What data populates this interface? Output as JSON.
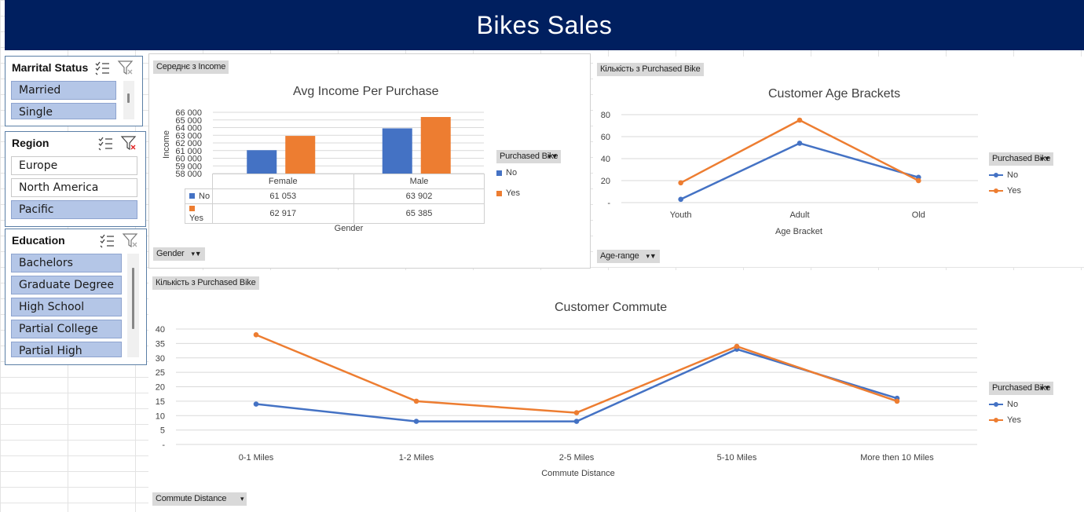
{
  "app": {
    "title": "Bikes Sales"
  },
  "colors": {
    "banner": "#001f5f",
    "no": "#4472c4",
    "yes": "#ed7d31",
    "selected": "#b4c6e7"
  },
  "slicers": {
    "marital": {
      "title": "Marrital Status",
      "items": [
        {
          "label": "Married",
          "selected": true
        },
        {
          "label": "Single",
          "selected": true
        }
      ]
    },
    "region": {
      "title": "Region",
      "items": [
        {
          "label": "Europe",
          "selected": false
        },
        {
          "label": "North America",
          "selected": false
        },
        {
          "label": "Pacific",
          "selected": true
        }
      ]
    },
    "education": {
      "title": "Education",
      "items": [
        {
          "label": "Bachelors",
          "selected": true
        },
        {
          "label": "Graduate Degree",
          "selected": true
        },
        {
          "label": "High School",
          "selected": true
        },
        {
          "label": "Partial College",
          "selected": true
        },
        {
          "label": "Partial High School",
          "selected": true
        }
      ]
    },
    "icons": [
      "multi-select-icon",
      "clear-filter-icon"
    ]
  },
  "income_chart": {
    "value_button": "Середнє з Income",
    "axis_button": "Gender",
    "legend_button": "Purchased Bike",
    "chart_data": {
      "type": "bar",
      "title": "Avg Income Per Purchase",
      "xlabel": "Gender",
      "ylabel": "Income",
      "categories": [
        "Female",
        "Male"
      ],
      "series": [
        {
          "name": "No",
          "values": [
            61053,
            63902
          ]
        },
        {
          "name": "Yes",
          "values": [
            62917,
            65385
          ]
        }
      ],
      "ylim": [
        58000,
        66000
      ],
      "yticks": [
        "66 000",
        "65 000",
        "64 000",
        "63 000",
        "62 000",
        "61 000",
        "60 000",
        "59 000",
        "58 000"
      ],
      "table": {
        "No": [
          "61 053",
          "63 902"
        ],
        "Yes": [
          "62 917",
          "65 385"
        ]
      },
      "legend": [
        "No",
        "Yes"
      ]
    }
  },
  "age_chart": {
    "value_button": "Кількість з Purchased Bike",
    "axis_button": "Age-range",
    "legend_button": "Purchased Bike",
    "chart_data": {
      "type": "line",
      "title": "Customer Age Brackets",
      "xlabel": "Age Bracket",
      "ylabel": "",
      "categories": [
        "Youth",
        "Adult",
        "Old"
      ],
      "series": [
        {
          "name": "No",
          "values": [
            3,
            54,
            23
          ]
        },
        {
          "name": "Yes",
          "values": [
            18,
            75,
            20
          ]
        }
      ],
      "ylim": [
        0,
        80
      ],
      "yticks": [
        "80",
        "60",
        "40",
        "20",
        "-"
      ],
      "legend": [
        "No",
        "Yes"
      ]
    }
  },
  "commute_chart": {
    "value_button": "Кількість з Purchased Bike",
    "axis_button": "Commute Distance",
    "legend_button": "Purchased Bike",
    "chart_data": {
      "type": "line",
      "title": "Customer Commute",
      "xlabel": "Commute Distance",
      "ylabel": "",
      "categories": [
        "0-1 Miles",
        "1-2 Miles",
        "2-5 Miles",
        "5-10 Miles",
        "More then 10 Miles"
      ],
      "series": [
        {
          "name": "No",
          "values": [
            14,
            8,
            8,
            33,
            16
          ]
        },
        {
          "name": "Yes",
          "values": [
            38,
            15,
            11,
            34,
            15
          ]
        }
      ],
      "ylim": [
        0,
        40
      ],
      "yticks": [
        "40",
        "35",
        "30",
        "25",
        "20",
        "15",
        "10",
        "5",
        "-"
      ],
      "legend": [
        "No",
        "Yes"
      ]
    }
  }
}
